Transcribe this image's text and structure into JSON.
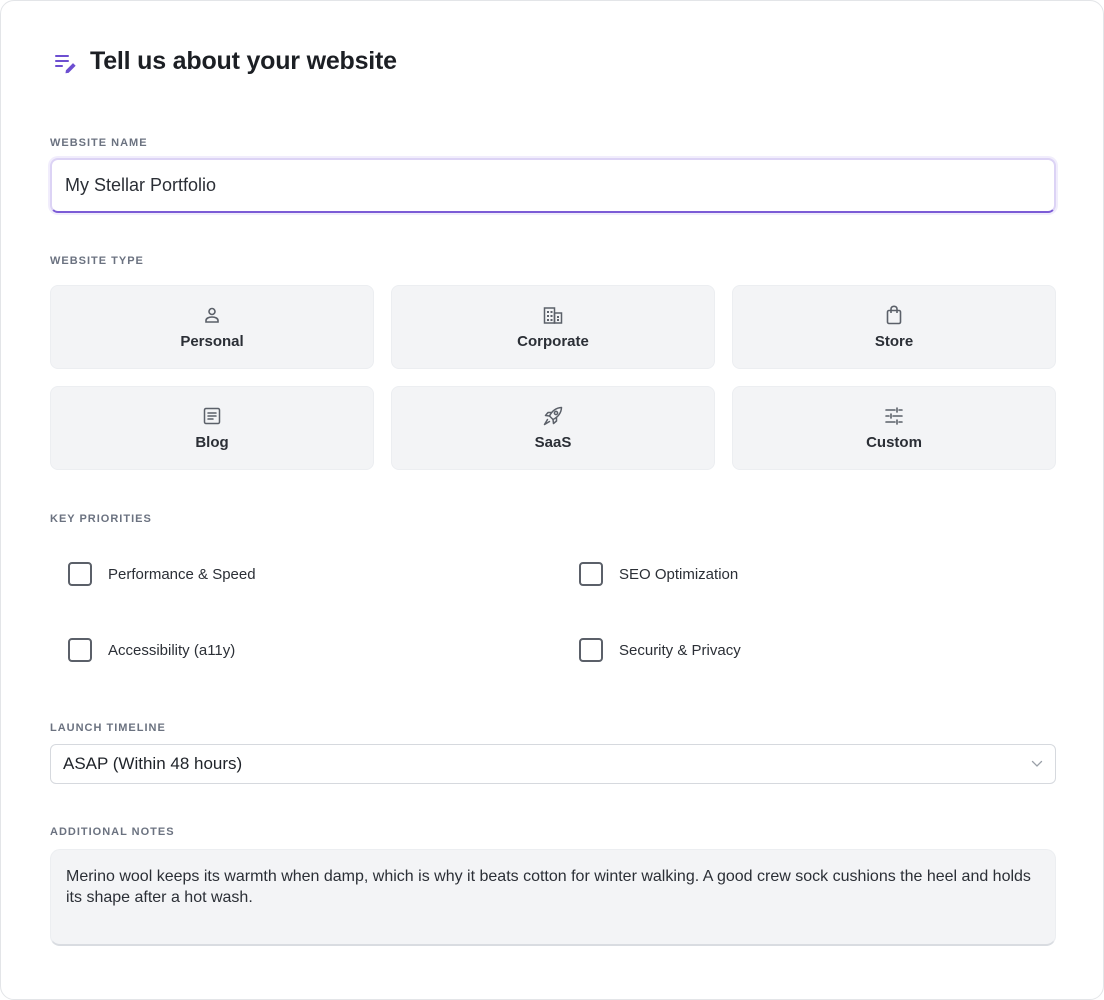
{
  "header": {
    "title": "Tell us about your website",
    "icon": "edit-list-icon",
    "accent": "#6d4fd1"
  },
  "website_name": {
    "label": "WEBSITE NAME",
    "value": "My Stellar Portfolio"
  },
  "website_type": {
    "label": "WEBSITE TYPE",
    "options": [
      {
        "label": "Personal",
        "icon": "person-icon"
      },
      {
        "label": "Corporate",
        "icon": "building-icon"
      },
      {
        "label": "Store",
        "icon": "shopping-bag-icon"
      },
      {
        "label": "Blog",
        "icon": "article-icon"
      },
      {
        "label": "SaaS",
        "icon": "rocket-icon"
      },
      {
        "label": "Custom",
        "icon": "sliders-icon"
      }
    ]
  },
  "priorities": {
    "label": "KEY PRIORITIES",
    "items": [
      {
        "label": "Performance & Speed",
        "checked": false
      },
      {
        "label": "SEO Optimization",
        "checked": false
      },
      {
        "label": "Accessibility (a11y)",
        "checked": false
      },
      {
        "label": "Security & Privacy",
        "checked": false
      }
    ]
  },
  "timeline": {
    "label": "LAUNCH TIMELINE",
    "selected": "ASAP (Within 48 hours)"
  },
  "notes": {
    "label": "ADDITIONAL NOTES",
    "value": "Merino wool keeps its warmth when damp, which is why it beats cotton for winter walking. A good crew sock cushions the heel and holds its shape after a hot wash."
  }
}
